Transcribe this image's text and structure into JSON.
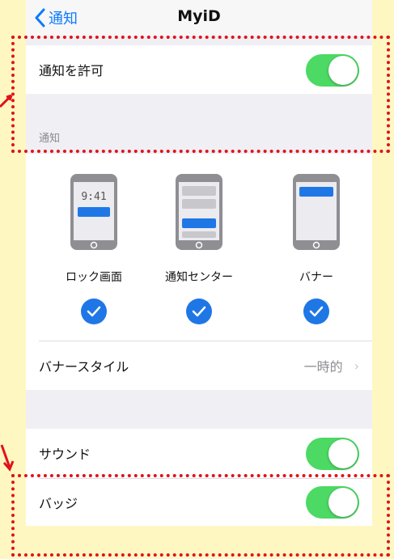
{
  "nav": {
    "back_label": "通知",
    "title": "MyiD"
  },
  "allow_notifications": {
    "label": "通知を許可",
    "on": true
  },
  "section_header": "通知",
  "alert_styles": [
    {
      "label": "ロック画面",
      "time": "9:41",
      "checked": true
    },
    {
      "label": "通知センター",
      "checked": true
    },
    {
      "label": "バナー",
      "checked": true
    }
  ],
  "banner_style": {
    "label": "バナースタイル",
    "value": "一時的"
  },
  "sounds": {
    "label": "サウンド",
    "on": true
  },
  "badges": {
    "label": "バッジ",
    "on": true
  },
  "colors": {
    "accent": "#0a7aff",
    "toggle_on": "#4cd964",
    "check": "#1f77e6",
    "highlight": "#e0131a",
    "background": "#fff7c2"
  }
}
